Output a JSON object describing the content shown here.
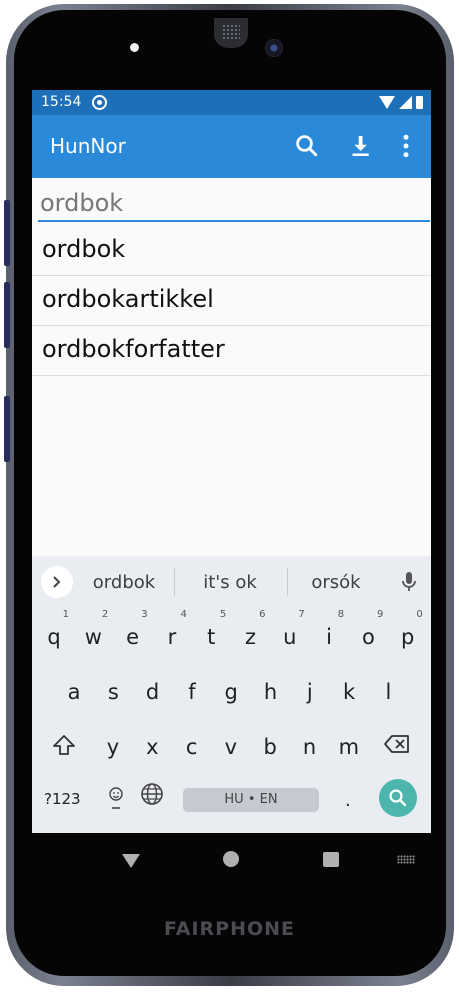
{
  "status_bar": {
    "time": "15:54"
  },
  "app_bar": {
    "title": "HunNor"
  },
  "search": {
    "query": "ordbok"
  },
  "results": [
    "ordbok",
    "ordbokartikkel",
    "ordbokforfatter"
  ],
  "keyboard": {
    "suggestions": [
      "ordbok",
      "it's ok",
      "orsók"
    ],
    "row1": [
      {
        "key": "q",
        "hint": "1"
      },
      {
        "key": "w",
        "hint": "2"
      },
      {
        "key": "e",
        "hint": "3"
      },
      {
        "key": "r",
        "hint": "4"
      },
      {
        "key": "t",
        "hint": "5"
      },
      {
        "key": "z",
        "hint": "6"
      },
      {
        "key": "u",
        "hint": "7"
      },
      {
        "key": "i",
        "hint": "8"
      },
      {
        "key": "o",
        "hint": "9"
      },
      {
        "key": "p",
        "hint": "0"
      }
    ],
    "row2": [
      "a",
      "s",
      "d",
      "f",
      "g",
      "h",
      "j",
      "k",
      "l"
    ],
    "row3": [
      "y",
      "x",
      "c",
      "v",
      "b",
      "n",
      "m"
    ],
    "symbols_key": "?123",
    "space_label": "HU • EN",
    "period_key": ".",
    "emoji_hint": "☺"
  },
  "device": {
    "brand": "FAIRPHONE"
  },
  "colors": {
    "status_bar": "#1d6fb8",
    "app_bar": "#2a8ad9",
    "enter_key": "#4db6ac"
  }
}
